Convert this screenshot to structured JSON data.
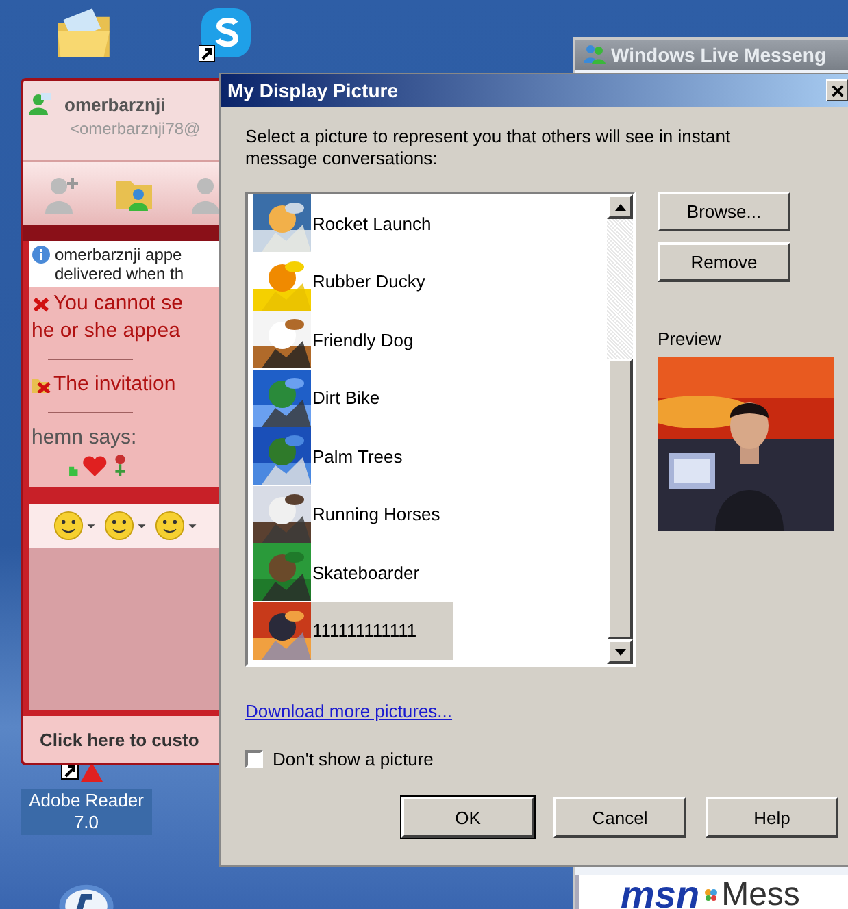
{
  "desktop": {
    "icon_label": "Adobe Reader 7.0"
  },
  "messenger_window": {
    "title": "Windows Live Messeng",
    "logo": "msn",
    "logo_caption": "Mess"
  },
  "chat_window": {
    "contact_name": "omerbarznji",
    "contact_email": "<omerbarznji78@",
    "messages": [
      {
        "kind": "info",
        "lines": [
          "omerbarznji appe",
          "delivered when th"
        ]
      },
      {
        "kind": "error",
        "lines": [
          "You cannot se",
          "he or she appea"
        ]
      },
      {
        "kind": "invite",
        "lines": [
          "The invitation"
        ]
      },
      {
        "kind": "said",
        "lines": [
          "hemn says:"
        ]
      }
    ],
    "footer": "Click here to custo"
  },
  "dialog": {
    "title": "My Display Picture",
    "instruction": "Select a picture to represent you that others will see in instant message conversations:",
    "pictures": [
      {
        "label": "Rocket Launch",
        "selected": false
      },
      {
        "label": "Rubber Ducky",
        "selected": false
      },
      {
        "label": "Friendly Dog",
        "selected": false
      },
      {
        "label": "Dirt Bike",
        "selected": false
      },
      {
        "label": "Palm Trees",
        "selected": false
      },
      {
        "label": "Running Horses",
        "selected": false
      },
      {
        "label": "Skateboarder",
        "selected": false
      },
      {
        "label": "111111111111",
        "selected": true
      }
    ],
    "side_buttons": [
      "Browse...",
      "Remove"
    ],
    "preview_label": "Preview",
    "link": "Download more pictures...",
    "checkbox": {
      "label": "Don't show a picture",
      "checked": false
    },
    "buttons": [
      "OK",
      "Cancel",
      "Help"
    ]
  }
}
